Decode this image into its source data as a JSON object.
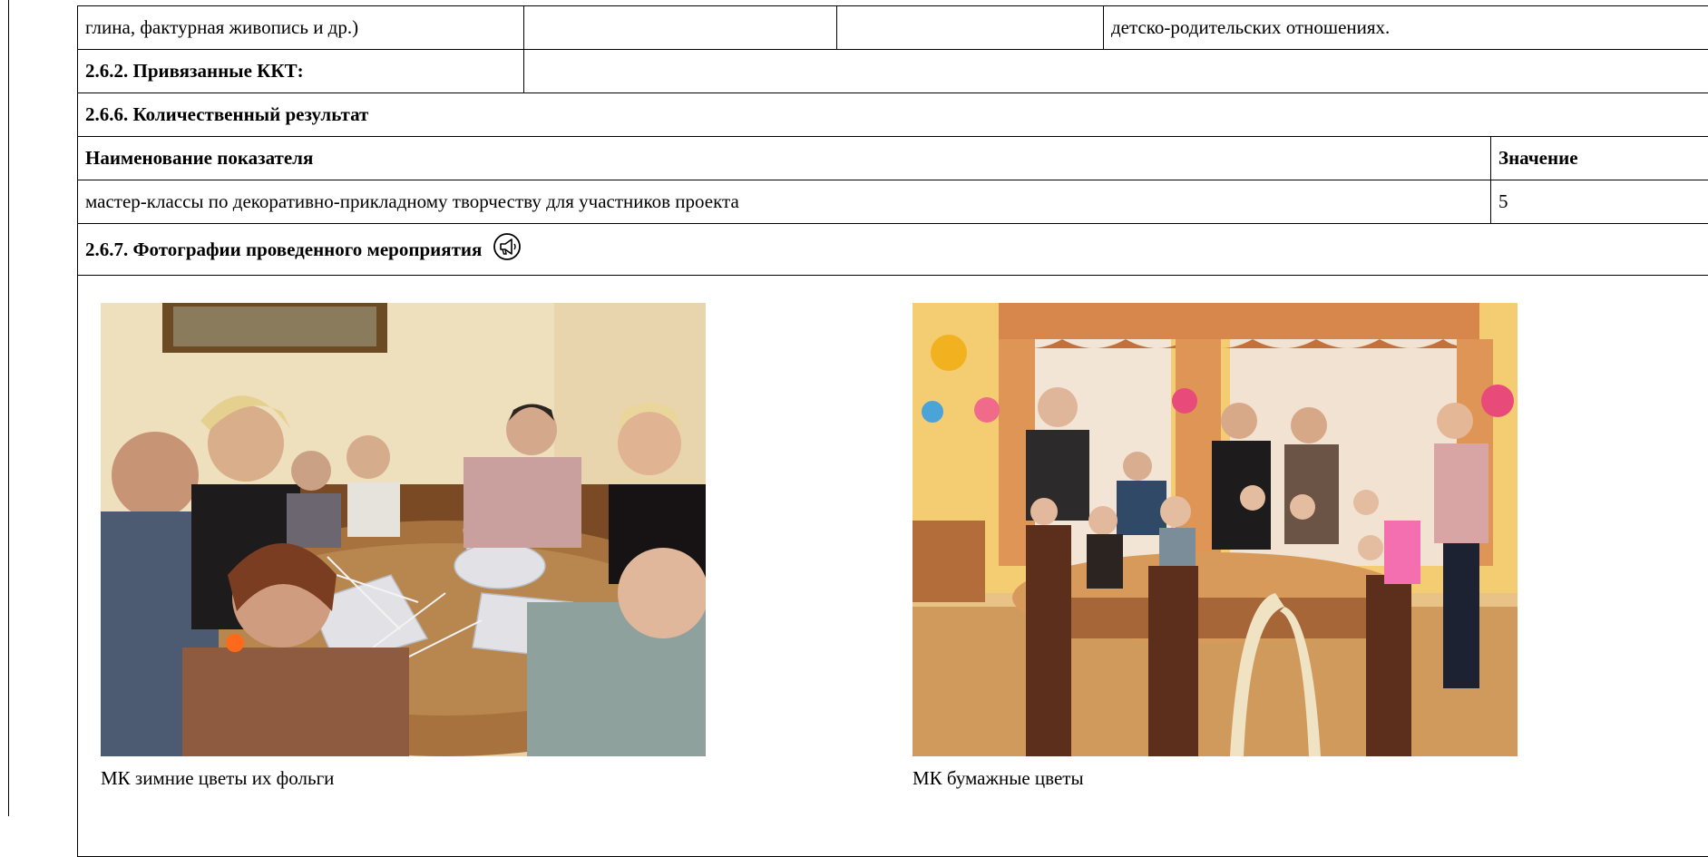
{
  "table": {
    "row_top": {
      "col1": "глина, фактурная живопись и др.)",
      "col2": "",
      "col3": "",
      "col4": "детско-родительских отношениях."
    },
    "linked_kkt": {
      "label": "2.6.2. Привязанные ККТ:",
      "value": ""
    },
    "quant_result": {
      "title": "2.6.6. Количественный результат",
      "header_name": "Наименование показателя",
      "header_value": "Значение",
      "rows": [
        {
          "name": "мастер-классы по декоративно-прикладному творчеству для участников проекта",
          "value": "5"
        }
      ]
    },
    "photos": {
      "title": "2.6.7. Фотографии проведенного мероприятия",
      "icon": "megaphone-icon",
      "items": [
        {
          "caption": "МК зимние цветы их фольги"
        },
        {
          "caption": "МК бумажные цветы"
        }
      ]
    }
  }
}
